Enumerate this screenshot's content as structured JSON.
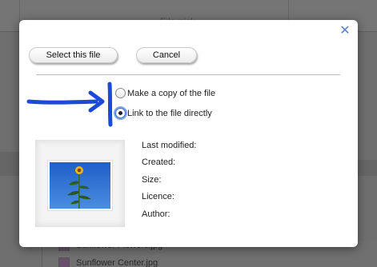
{
  "background": {
    "header_title": "File pick",
    "files": [
      "Sunflower Flowers.jpg",
      "Sunflower Center.jpg"
    ]
  },
  "dialog": {
    "close_icon": "close-icon",
    "select_button": "Select this file",
    "cancel_button": "Cancel",
    "options": {
      "copy_label": "Make a copy of the file",
      "link_label": "Link to the file directly",
      "selected": "link"
    },
    "preview": {
      "alt": "sunflower thumbnail"
    },
    "metadata": {
      "last_modified": "Last modified:",
      "created": "Created:",
      "size": "Size:",
      "licence": "Licence:",
      "author": "Author:"
    }
  },
  "colors": {
    "accent": "#3f6fd0",
    "annotation": "#1d49d8",
    "overlay": "#6f6f6f"
  }
}
